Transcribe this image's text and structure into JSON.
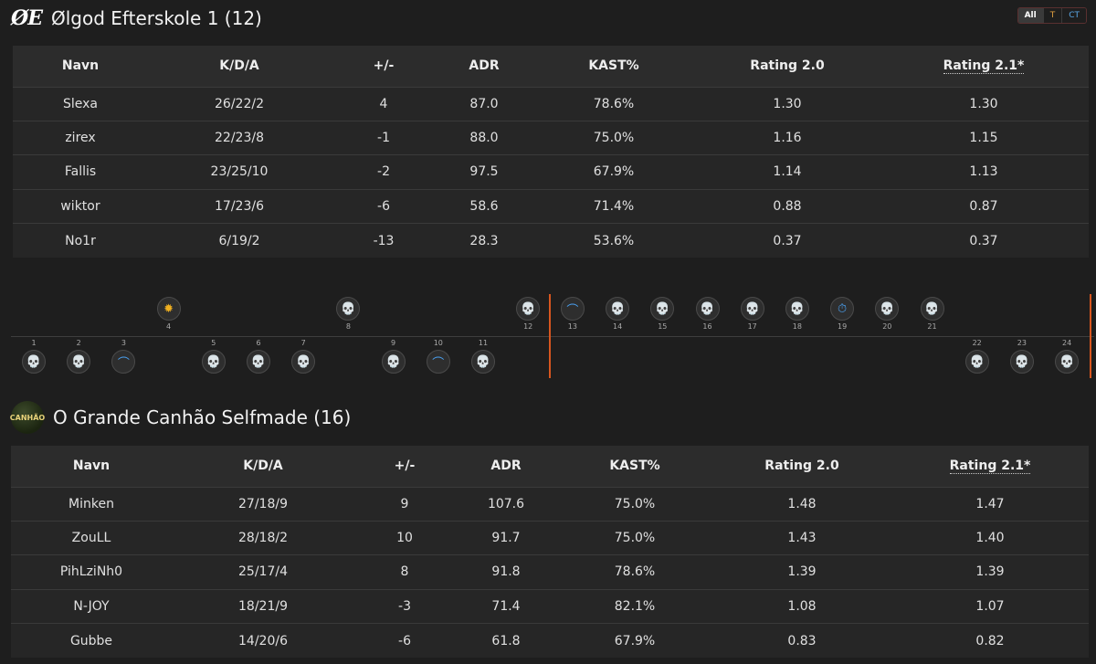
{
  "filter": {
    "all": "All",
    "t": "T",
    "ct": "CT"
  },
  "team1": {
    "logo_text": "ØE",
    "title": "Ølgod Efterskole 1 (12)",
    "headers": [
      "Navn",
      "K/D/A",
      "+/-",
      "ADR",
      "KAST%",
      "Rating 2.0",
      "Rating 2.1*"
    ],
    "rows": [
      [
        "Slexa",
        "26/22/2",
        "4",
        "87.0",
        "78.6%",
        "1.30",
        "1.30"
      ],
      [
        "zirex",
        "22/23/8",
        "-1",
        "88.0",
        "75.0%",
        "1.16",
        "1.15"
      ],
      [
        "Fallis",
        "23/25/10",
        "-2",
        "97.5",
        "67.9%",
        "1.14",
        "1.13"
      ],
      [
        "wiktor",
        "17/23/6",
        "-6",
        "58.6",
        "71.4%",
        "0.88",
        "0.87"
      ],
      [
        "No1r",
        "6/19/2",
        "-13",
        "28.3",
        "53.6%",
        "0.37",
        "0.37"
      ]
    ]
  },
  "team2": {
    "logo_text": "CANHÃO",
    "title": "O Grande Canhão Selfmade (16)",
    "headers": [
      "Navn",
      "K/D/A",
      "+/-",
      "ADR",
      "KAST%",
      "Rating 2.0",
      "Rating 2.1*"
    ],
    "rows": [
      [
        "Minken",
        "27/18/9",
        "9",
        "107.6",
        "75.0%",
        "1.48",
        "1.47"
      ],
      [
        "ZouLL",
        "28/18/2",
        "10",
        "91.7",
        "75.0%",
        "1.43",
        "1.40"
      ],
      [
        "PihLziNh0",
        "25/17/4",
        "8",
        "91.8",
        "78.6%",
        "1.39",
        "1.39"
      ],
      [
        "N-JOY",
        "18/21/9",
        "-3",
        "71.4",
        "82.1%",
        "1.08",
        "1.07"
      ],
      [
        "Gubbe",
        "14/20/6",
        "-6",
        "61.8",
        "67.9%",
        "0.83",
        "0.82"
      ]
    ]
  },
  "rounds": [
    {
      "n": "1",
      "winner": "team2",
      "side": "ct",
      "icon": "skull-icon"
    },
    {
      "n": "2",
      "winner": "team2",
      "side": "ct",
      "icon": "skull-icon"
    },
    {
      "n": "3",
      "winner": "team2",
      "side": "ct",
      "icon": "defuse-icon"
    },
    {
      "n": "4",
      "winner": "team1",
      "side": "t",
      "icon": "bomb-explode-icon"
    },
    {
      "n": "5",
      "winner": "team2",
      "side": "ct",
      "icon": "skull-icon"
    },
    {
      "n": "6",
      "winner": "team2",
      "side": "ct",
      "icon": "skull-icon"
    },
    {
      "n": "7",
      "winner": "team2",
      "side": "ct",
      "icon": "skull-icon"
    },
    {
      "n": "8",
      "winner": "team1",
      "side": "t",
      "icon": "skull-icon"
    },
    {
      "n": "9",
      "winner": "team2",
      "side": "ct",
      "icon": "skull-icon"
    },
    {
      "n": "10",
      "winner": "team2",
      "side": "ct",
      "icon": "defuse-icon"
    },
    {
      "n": "11",
      "winner": "team2",
      "side": "ct",
      "icon": "skull-icon"
    },
    {
      "n": "12",
      "winner": "team1",
      "side": "t",
      "icon": "skull-icon"
    },
    {
      "n": "13",
      "winner": "team1",
      "side": "ct",
      "icon": "defuse-icon"
    },
    {
      "n": "14",
      "winner": "team1",
      "side": "ct",
      "icon": "skull-icon"
    },
    {
      "n": "15",
      "winner": "team1",
      "side": "ct",
      "icon": "skull-icon"
    },
    {
      "n": "16",
      "winner": "team1",
      "side": "ct",
      "icon": "skull-icon"
    },
    {
      "n": "17",
      "winner": "team1",
      "side": "ct",
      "icon": "skull-icon"
    },
    {
      "n": "18",
      "winner": "team1",
      "side": "ct",
      "icon": "skull-icon"
    },
    {
      "n": "19",
      "winner": "team1",
      "side": "ct",
      "icon": "stopwatch-icon"
    },
    {
      "n": "20",
      "winner": "team1",
      "side": "ct",
      "icon": "skull-icon"
    },
    {
      "n": "21",
      "winner": "team1",
      "side": "ct",
      "icon": "skull-icon"
    },
    {
      "n": "22",
      "winner": "team2",
      "side": "t",
      "icon": "skull-icon"
    },
    {
      "n": "23",
      "winner": "team2",
      "side": "t",
      "icon": "skull-icon"
    },
    {
      "n": "24",
      "winner": "team2",
      "side": "t",
      "icon": "skull-icon"
    }
  ],
  "colors": {
    "ct": "#4aa0f0",
    "t": "#f0b020",
    "half_marker": "#d8561f"
  }
}
